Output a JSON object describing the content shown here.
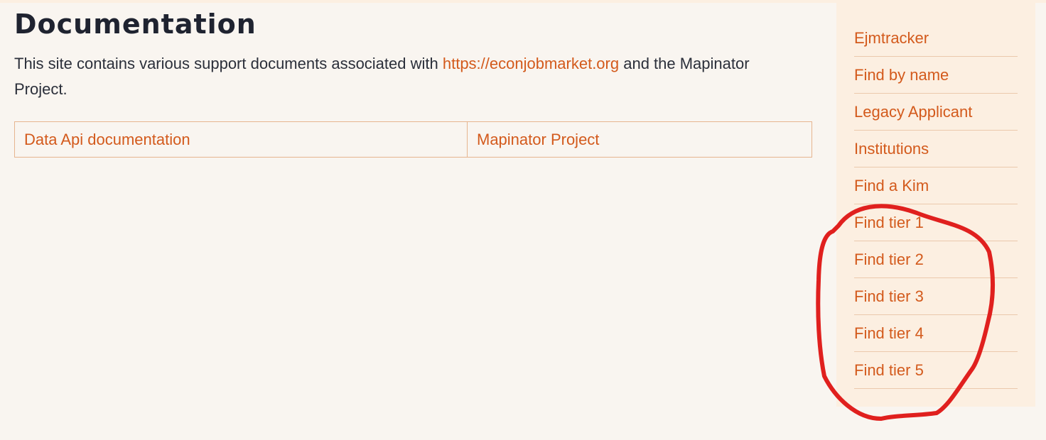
{
  "main": {
    "title": "Documentation",
    "intro_before": "This site contains various support documents associated with ",
    "intro_link": "https://econjobmarket.org",
    "intro_after": " and the Mapinator Project."
  },
  "doc_links": [
    {
      "label": "Data Api documentation"
    },
    {
      "label": "Mapinator Project"
    }
  ],
  "sidebar": {
    "items": [
      {
        "label": "Ejmtracker"
      },
      {
        "label": "Find by name"
      },
      {
        "label": "Legacy Applicant"
      },
      {
        "label": "Institutions"
      },
      {
        "label": "Find a Kim"
      },
      {
        "label": "Find tier 1"
      },
      {
        "label": "Find tier 2"
      },
      {
        "label": "Find tier 3"
      },
      {
        "label": "Find tier 4"
      },
      {
        "label": "Find tier 5"
      }
    ]
  },
  "colors": {
    "background": "#f9f5f0",
    "sidebar_background": "#fcefe1",
    "link": "#d35a1c",
    "text": "#2b2f3a",
    "annotation": "#e0201e"
  }
}
